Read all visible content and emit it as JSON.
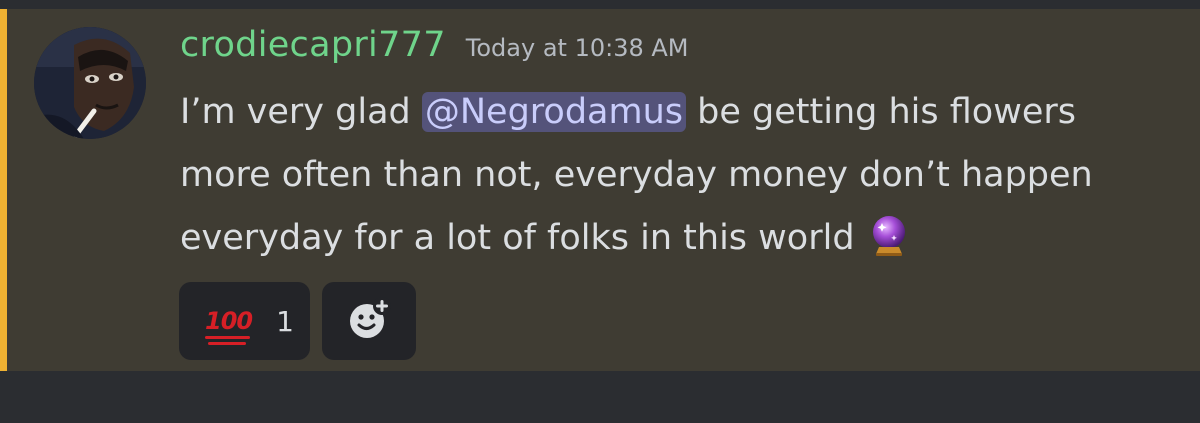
{
  "message": {
    "author": "crodiecapri777",
    "timestamp": "Today at 10:38 AM",
    "lines": {
      "line1_before": "I’m very glad ",
      "mention": "@Negrodamus",
      "line1_after": " be getting his flowers",
      "line2": "more often than not, everyday money don’t happen",
      "line3": "everyday for a lot of folks in this world"
    },
    "inline_emoji": "crystal-ball"
  },
  "reactions": [
    {
      "emoji": "100",
      "count": "1"
    }
  ],
  "colors": {
    "background": "#2b2d31",
    "message_highlight": "#3f3c33",
    "highlight_bar": "#f0b232",
    "username": "#6fd48b",
    "mention_bg": "#54537a",
    "mention_text": "#c9cdfb",
    "reaction_bg": "#232428"
  },
  "icons": {
    "add_reaction": "add-reaction-icon"
  }
}
